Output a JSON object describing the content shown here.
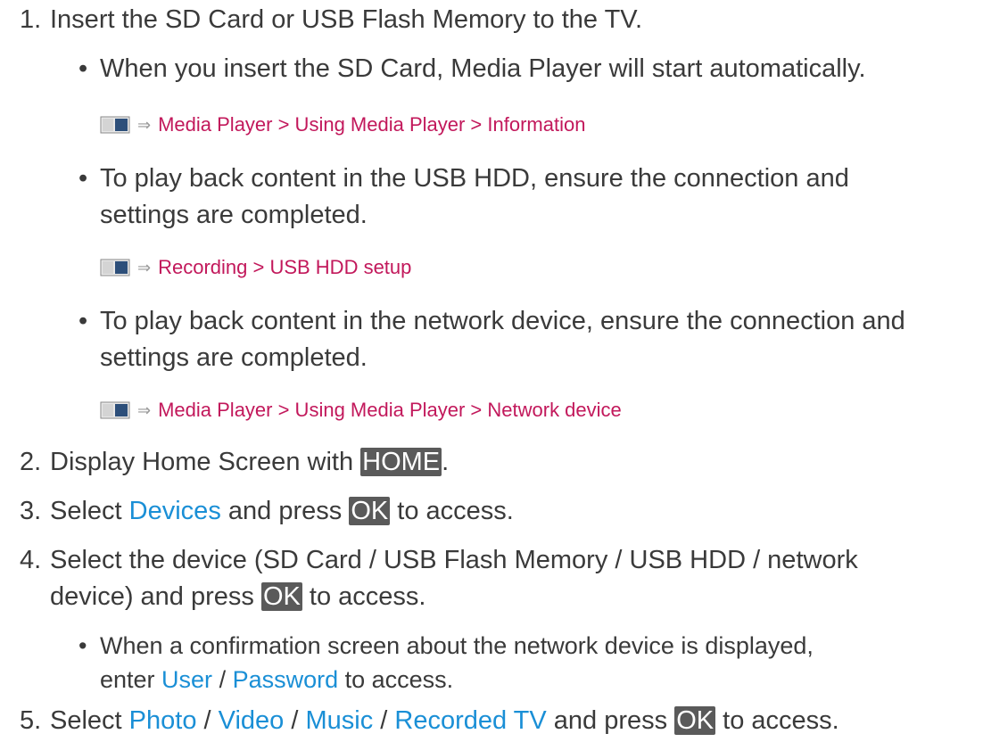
{
  "steps": [
    {
      "num": "1.",
      "text": "Insert the SD Card or USB Flash Memory to the TV."
    },
    {
      "num": "2.",
      "text_before": "Display Home Screen with ",
      "key": "HOME",
      "text_after": "."
    },
    {
      "num": "3.",
      "text_before": "Select ",
      "link": "Devices",
      "text_mid": " and press ",
      "key": "OK",
      "text_after": " to access."
    },
    {
      "num": "4.",
      "line1": "Select the device (SD Card / USB Flash Memory / USB HDD / network",
      "line2_before": "device) and press ",
      "key": "OK",
      "line2_after": " to access."
    },
    {
      "num": "5.",
      "text_before": "Select ",
      "links": [
        "Photo",
        "Video",
        "Music",
        "Recorded TV"
      ],
      "sep": " / ",
      "text_mid": " and press ",
      "key": "OK",
      "text_after": " to access."
    }
  ],
  "bullets": {
    "b1": {
      "text": "When you insert the SD Card, Media Player will start automatically."
    },
    "b2": {
      "line1": "To play back content in the USB HDD, ensure the connection and",
      "line2": "settings are completed."
    },
    "b3": {
      "line1": "To play back content in the network device, ensure the connection and",
      "line2": "settings are completed."
    },
    "b4": {
      "line1": "When a confirmation screen about the network device is displayed,",
      "line2_before": "enter ",
      "user": "User",
      "sep": " / ",
      "password": "Password",
      "line2_after": " to access."
    }
  },
  "refs": {
    "r1": "Media Player > Using Media Player > Information",
    "r2": "Recording > USB HDD setup",
    "r3": "Media Player > Using Media Player > Network device"
  },
  "bullet_glyph": "•",
  "ref_arrow": "⇒",
  "colors": {
    "link_blue": "#1a8fd6",
    "ref_pink": "#c2185b",
    "key_bg": "#5a5a5a",
    "text": "#3a3a3a"
  }
}
